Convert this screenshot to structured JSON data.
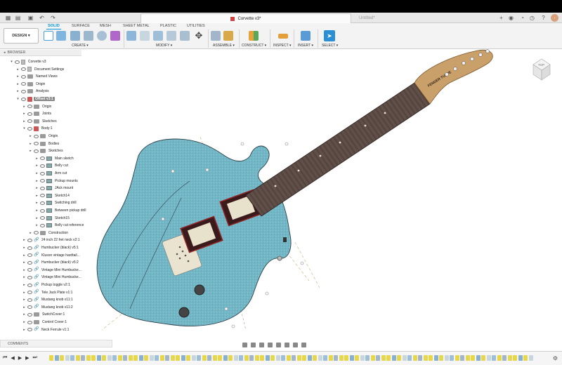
{
  "app": {
    "doc_tabs": [
      {
        "label": "Corvette v3*",
        "active": true
      },
      {
        "label": "Untitled*",
        "active": false
      }
    ]
  },
  "ribbon": {
    "workspace": "DESIGN ▾",
    "tabs": [
      "SOLID",
      "SURFACE",
      "MESH",
      "SHEET METAL",
      "PLASTIC",
      "UTILITIES"
    ],
    "active_tab": "SOLID",
    "groups": [
      "CREATE ▾",
      "MODIFY ▾",
      "ASSEMBLE ▾",
      "CONSTRUCT ▾",
      "INSPECT ▾",
      "INSERT ▾",
      "SELECT ▾"
    ]
  },
  "browser": {
    "title": "BROWSER",
    "items": [
      {
        "label": "Corvette v3",
        "level": 0,
        "icon": "doc"
      },
      {
        "label": "Document Settings",
        "level": 1,
        "icon": "gear"
      },
      {
        "label": "Named Views",
        "level": 1,
        "icon": "folder"
      },
      {
        "label": "Origin",
        "level": 1,
        "icon": "folder"
      },
      {
        "label": "Analysis",
        "level": 1,
        "icon": "folder"
      },
      {
        "label": "Offset v3:1",
        "level": 1,
        "icon": "comp",
        "selected": true
      },
      {
        "label": "Origin",
        "level": 2,
        "icon": "folder"
      },
      {
        "label": "Joints",
        "level": 2,
        "icon": "folder"
      },
      {
        "label": "Sketches",
        "level": 2,
        "icon": "folder"
      },
      {
        "label": "Body:1",
        "level": 2,
        "icon": "comp"
      },
      {
        "label": "Origin",
        "level": 3,
        "icon": "folder"
      },
      {
        "label": "Bodies",
        "level": 3,
        "icon": "folder"
      },
      {
        "label": "Sketches",
        "level": 3,
        "icon": "folder"
      },
      {
        "label": "Main sketch",
        "level": 4,
        "icon": "sketch"
      },
      {
        "label": "Belly cut",
        "level": 4,
        "icon": "sketch"
      },
      {
        "label": "Arm cut",
        "level": 4,
        "icon": "sketch"
      },
      {
        "label": "Pickup mounts",
        "level": 4,
        "icon": "sketch"
      },
      {
        "label": "JAck mount",
        "level": 4,
        "icon": "sketch"
      },
      {
        "label": "Sketch14",
        "level": 4,
        "icon": "sketch"
      },
      {
        "label": "Switching drill",
        "level": 4,
        "icon": "sketch"
      },
      {
        "label": "Between pickup drill",
        "level": 4,
        "icon": "sketch"
      },
      {
        "label": "Sketch15",
        "level": 4,
        "icon": "sketch"
      },
      {
        "label": "Belly cut reference",
        "level": 4,
        "icon": "sketch"
      },
      {
        "label": "Construction",
        "level": 3,
        "icon": "folder"
      },
      {
        "label": "24 inch 22 fret neck v2:1",
        "level": 2,
        "icon": "link"
      },
      {
        "label": "Humbucker (black) v5:1",
        "level": 2,
        "icon": "link"
      },
      {
        "label": "Kluson vintage hardtail...",
        "level": 2,
        "icon": "link"
      },
      {
        "label": "Humbucker (black) v5:2",
        "level": 2,
        "icon": "link"
      },
      {
        "label": "Vintage Mini Humbucke...",
        "level": 2,
        "icon": "link"
      },
      {
        "label": "Vintage Mini Humbucke...",
        "level": 2,
        "icon": "link"
      },
      {
        "label": "Pickup toggle v2:1",
        "level": 2,
        "icon": "link"
      },
      {
        "label": "Tele Jack Plate v1:1",
        "level": 2,
        "icon": "link"
      },
      {
        "label": "Mustang knob v11:1",
        "level": 2,
        "icon": "link"
      },
      {
        "label": "Mustang knob v11:2",
        "level": 2,
        "icon": "link"
      },
      {
        "label": "SwitchCover:1",
        "level": 2,
        "icon": "folder"
      },
      {
        "label": "Control Cover:1",
        "level": 2,
        "icon": "folder"
      },
      {
        "label": "Neck Ferrule v1:1",
        "level": 2,
        "icon": "link"
      }
    ]
  },
  "comments": {
    "label": "COMMENTS"
  },
  "viewcube": {
    "label": "TOP"
  },
  "headstock_logo": "FENDER TUPPE",
  "colors": {
    "accent": "#0696d7",
    "body": "#6fb3c4",
    "neck": "#5a4a44",
    "headstock": "#c9a06a"
  }
}
